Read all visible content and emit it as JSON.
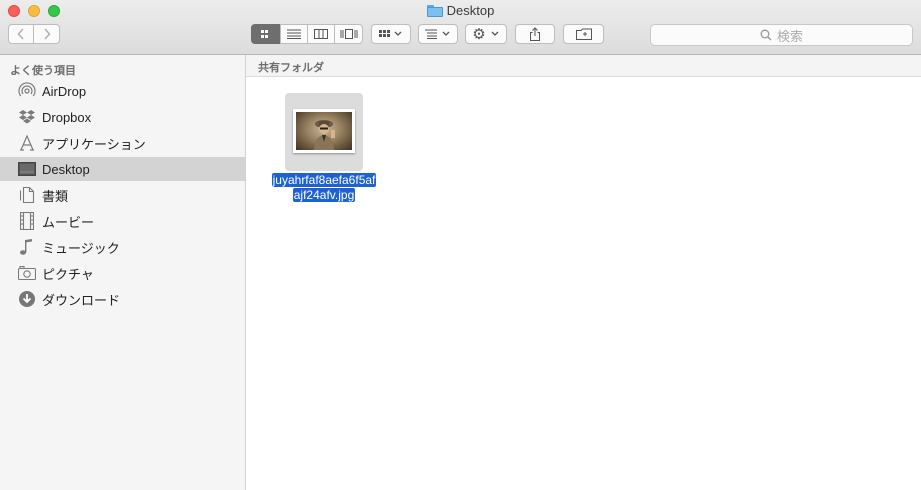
{
  "window": {
    "title": "Desktop"
  },
  "toolbar": {
    "search_placeholder": "検索",
    "icons": {
      "back": "chevron-left-icon",
      "forward": "chevron-right-icon",
      "view_icon": "icon-view-icon",
      "view_list": "list-view-icon",
      "view_column": "column-view-icon",
      "view_coverflow": "coverflow-view-icon",
      "arrange": "arrange-icon",
      "sort": "sort-icon",
      "action": "gear-icon",
      "share": "share-icon",
      "tags": "tag-folder-icon"
    }
  },
  "sidebar": {
    "header": "よく使う項目",
    "items": [
      {
        "label": "AirDrop",
        "icon": "airdrop-icon"
      },
      {
        "label": "Dropbox",
        "icon": "dropbox-icon"
      },
      {
        "label": "アプリケーション",
        "icon": "applications-icon"
      },
      {
        "label": "Desktop",
        "icon": "desktop-icon",
        "selected": true
      },
      {
        "label": "書類",
        "icon": "documents-icon"
      },
      {
        "label": "ムービー",
        "icon": "movies-icon"
      },
      {
        "label": "ミュージック",
        "icon": "music-icon"
      },
      {
        "label": "ピクチャ",
        "icon": "pictures-icon"
      },
      {
        "label": "ダウンロード",
        "icon": "downloads-icon"
      }
    ]
  },
  "content": {
    "header": "共有フォルダ",
    "files": [
      {
        "name_line1": "juyahrfaf8aefa6f5af",
        "name_line2": "ajf24afv.jpg",
        "selected": true
      }
    ]
  },
  "colors": {
    "selection": "#1e62d0",
    "sidebar_selected": "#d3d3d3",
    "view_active": "#6e6e6e"
  }
}
